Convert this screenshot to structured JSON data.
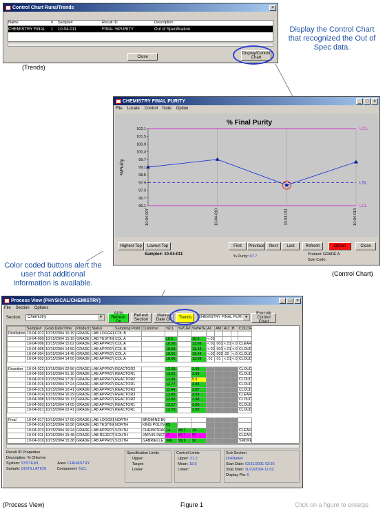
{
  "trends": {
    "title": "Control Chart Runs/Trends",
    "headers": [
      "Name",
      "#",
      "Sample#",
      "Result ID",
      "Description"
    ],
    "row": [
      "CHEMISTRY FINAL",
      "1",
      "10-04-011",
      "FINAL.%PURITY",
      "Out of Specification"
    ],
    "close": "Close",
    "display": "Display/Control Chart",
    "caption": "(Trends)"
  },
  "callouts": {
    "c1": "Display the Control Chart that recognized the Out of Spec data.",
    "c2": "Color coded buttons alert the user that additional information is available."
  },
  "control": {
    "title": "CHEMISTRY FINAL PURITY",
    "menu": [
      "File",
      "Locate",
      "Control",
      "Note",
      "Option"
    ],
    "caption": "(Control Chart)",
    "buttons": {
      "highest": "Highest Top",
      "lowest": "Lowest Top",
      "first": "First",
      "previous": "Previous",
      "next": "Next",
      "last": "Last",
      "refresh": "Refresh",
      "option": "Option",
      "close": "Close"
    },
    "sample": "Sample#: 10-04-011",
    "purity_label": "% Purity:",
    "purity_value": "97.7",
    "product": "Product: GRADE A",
    "size": "Size Code:"
  },
  "chart_data": {
    "type": "line",
    "title": "% Final Purity",
    "ylabel": "%Purity",
    "x": [
      "10-04-007",
      "10-04-010",
      "10-04-011",
      "10-04-013"
    ],
    "values": [
      99.1,
      99.7,
      97.7,
      99.5
    ],
    "yticks": [
      102.1,
      101.5,
      100.9,
      100.3,
      99.7,
      99.1,
      98.5,
      97.9,
      97.3,
      96.7,
      96.1
    ],
    "ylim": [
      96.1,
      102.1
    ],
    "lines": [
      {
        "name": "UCL",
        "value": 102.1,
        "color": "#cc33cc"
      },
      {
        "name": "LSL",
        "value": 97.9,
        "color": "#3333cc"
      },
      {
        "name": "LCL",
        "value": 96.1,
        "color": "#cc33cc"
      }
    ]
  },
  "process": {
    "title": "Process View (PHYSICAL/CHEMISTRY)",
    "menu": [
      "File",
      "Section",
      "Options"
    ],
    "section_label": "Section:",
    "section_value": "Chemistry",
    "btn_auto": "AUto Refresh On",
    "btn_refresh": "Refresh Section",
    "btn_manual": "Manual Date Off",
    "btn_trends": "Trends",
    "dropdown": "CHEMISTRY FINAL PURI",
    "btn_execute": "Execute Control Chart",
    "caption": "(Process View)",
    "headers": [
      "",
      "Sample#",
      "Grab Date/Time",
      "Product",
      "Status",
      "Sampling Point",
      "Customer",
      "%CL",
      "%PURITY",
      "%WATER",
      "AL",
      "AM",
      "AU",
      "B",
      "COLOR"
    ],
    "rows": [
      [
        "Distillation",
        "10-04-012",
        "10/15/2004 16:19",
        "GRADE B",
        "LAB LOGGED",
        "COL B",
        "",
        "",
        "",
        "",
        "",
        "",
        "",
        "",
        ""
      ],
      [
        "",
        "10-04-009",
        "10/15/2004 15:19",
        "GRADE A",
        "LAB TESTING",
        "COL A",
        "",
        "18.5",
        "",
        "15.6",
        "<.01",
        "",
        "",
        "",
        ""
      ],
      [
        "",
        "10-04-006",
        "10/15/2004 15:02",
        "GRADE A",
        "LAB APPROVED",
        "COL A",
        "",
        "18.56",
        "",
        "13.08",
        "<.01",
        ".001",
        "<.01",
        "<.01",
        "CLEAR"
      ],
      [
        "",
        "10-04-005",
        "10/15/2004 14:59",
        "GRADE B",
        "LAB APPROVED",
        "COL B",
        "",
        "18.54",
        "",
        "13.43",
        "<.01",
        ".001",
        "<.01",
        "<.01",
        "CLOUDY"
      ],
      [
        "",
        "10-04-004",
        "10/15/2004 14:45",
        "GRADE A",
        "LAB APPROVED",
        "COL A",
        "",
        "18.01",
        "",
        "13.44",
        "<.01",
        ".002",
        ".02",
        "<.01",
        "CLOUDY"
      ],
      [
        "",
        "10-04-002",
        "10/15/2004 14:00",
        "GRADE A",
        "LAB APPROVED",
        "COL A",
        "",
        "18.00",
        "",
        "13.68",
        ".01",
        ".01",
        "<.01",
        "<.01",
        "CLOUDY"
      ],
      [
        "Reaction",
        "10-04-022",
        "10/16/2004 02:56",
        "GRADE B",
        "LAB APPROVED",
        "REACTOR2",
        "",
        "12.39",
        "",
        "3.90",
        "",
        "",
        "",
        "",
        "CLOUDY"
      ],
      [
        "",
        "10-04-020",
        "10/16/2004 01:16",
        "GRADE A",
        "LAB APPROVED",
        "REACTOR1",
        "",
        "13.01",
        "",
        "3.98",
        "",
        "",
        "",
        "",
        "CLOUDY"
      ],
      [
        "",
        "10-04-019",
        "10/15/2004 17:30",
        "GRADE B",
        "LAB APPROVED",
        "REACTOR2",
        "",
        "11.98",
        "",
        "5.9",
        "",
        "",
        "",
        "",
        "CLOUDY"
      ],
      [
        "",
        "10-04-016",
        "10/15/2004 17:24",
        "GRADE A",
        "LAB APPROVED",
        "REACTOR1",
        "",
        "12.77",
        "",
        "3.88",
        "",
        "",
        "",
        "",
        "CLOUDY"
      ],
      [
        "",
        "10-04-015",
        "10/15/2004 16:41",
        "GRADE B",
        "LAB APPROVED",
        "REACTOR3",
        "",
        "11.44",
        "",
        "3.87",
        "",
        "",
        "",
        "",
        "CLOUDY"
      ],
      [
        "",
        "10-04-014",
        "10/15/2004 16:29",
        "GRADE B",
        "LAB APPROVED",
        "REACTOR3",
        "",
        "12.95",
        "",
        "3.93",
        "",
        "",
        "",
        "",
        "CLEAR"
      ],
      [
        "",
        "10-04-008",
        "10/15/2004 15:13",
        "GRADE B",
        "LAB APPROVED",
        "REACTOR2",
        "",
        "12.83",
        "",
        "3.88",
        "",
        "",
        "",
        "",
        "CLOUDY"
      ],
      [
        "",
        "10-04-003",
        "10/15/2004 14:05",
        "GRADE C",
        "LAB APPROVED",
        "REACTOR1",
        "",
        "12.17",
        "",
        "3.90",
        "",
        "",
        "",
        "",
        "CLOUDY"
      ],
      [
        "",
        "10-04-021",
        "10/15/2004 02:41",
        "GRADE A",
        "LAB APPROVED",
        "REACTOR1",
        "",
        "12.70",
        "",
        "3.89",
        "",
        "",
        "",
        "",
        "CLOUDY"
      ],
      [
        "Final",
        "10-04-017",
        "10/15/2004 17:09",
        "GRADE A",
        "LAB LOGGED",
        "NORTH",
        "BROMINE BUILDER",
        "",
        "",
        "",
        "",
        "",
        "",
        "",
        ""
      ],
      [
        "",
        "10-04-016",
        "10/15/2004 16:56",
        "GRADE A",
        "LAB TESTING",
        "NORTH",
        "KING POLYMERS",
        "05",
        "",
        "",
        "",
        "",
        "",
        "",
        ""
      ],
      [
        "",
        "10-04-013",
        "10/15/2004 16:24",
        "GRADE B",
        "LAB APPROVED",
        "SOUTH",
        "CHEMXTRACT",
        "14",
        "98.7",
        "14",
        "",
        "",
        "",
        "",
        "CLEAR"
      ],
      [
        "",
        "10-04-011",
        "10/15/2004 15:48",
        "GRADE A",
        "LAB REJECTED",
        "SOUTH",
        "JARVIS INSTITUT",
        ".7",
        "97.7",
        "97",
        "",
        "",
        "",
        "",
        "CLEAR"
      ],
      [
        "",
        "10-04-010",
        "10/15/2004 15:38",
        "GRADE A",
        "LAB APPROVED",
        "SOUTH",
        "GABRIELLE",
        "986",
        "99.9",
        "90",
        "",
        "",
        "",
        "",
        "SMOKEY"
      ],
      [
        "",
        "10-04-007",
        "10/15/2004 15:09",
        "GRADE A",
        "LAB APPROVED",
        "SOUTH",
        "CHEMVERT",
        "89",
        "99.1",
        "089",
        "",
        "",
        "",
        "",
        "CLEAR"
      ]
    ],
    "footer": {
      "rp_title": "Result ID Properties",
      "desc": "Description: % Chlorine",
      "system_label": "System:",
      "system": "SYSTEM1",
      "area_label": "Area:",
      "area": "CHEMISTRY",
      "sample_label": "Sample:",
      "sample": "DISTILLATION",
      "comp_label": "Component:",
      "comp": "%CL",
      "spec_title": "Specification Limits",
      "upper": "Upper:",
      "target": "Target:",
      "lower": "Lower:",
      "ctrl_title": "Control Limits",
      "c_upper": "Upper:",
      "c_upper_v": "21.2",
      "c_mean": "Mean:",
      "c_mean_v": "18.5",
      "c_lower": "Lower:",
      "sub_title": "Sub-Section",
      "sub_name": "Distillation",
      "start_label": "Start Date:",
      "start": "03/31/2001 03:02",
      "stop_label": "Stop Date:",
      "stop": "11/23/2004 11:02",
      "pts_label": "Display Pts:",
      "pts": "6"
    }
  },
  "figure": "Figure 1",
  "enlarge": "Click on a figure to enlarge"
}
